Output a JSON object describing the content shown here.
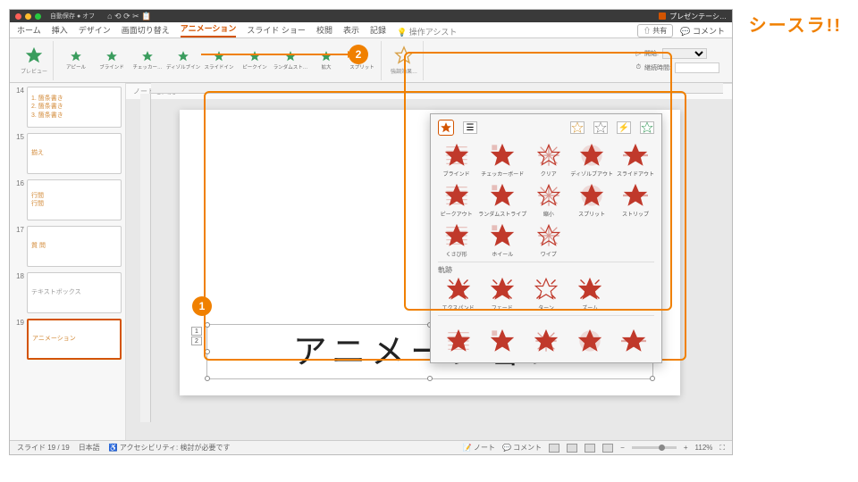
{
  "brand": "シースラ!!",
  "titlebar": {
    "autosave_label": "自動保存",
    "autosave_state": "オフ",
    "filename": "プレゼンテーシ…"
  },
  "tabs": {
    "items": [
      "ホーム",
      "挿入",
      "デザイン",
      "画面切り替え",
      "アニメーション",
      "スライド ショー",
      "校閲",
      "表示",
      "記録"
    ],
    "active_index": 4,
    "tell_me": "操作アシスト",
    "share": "共有",
    "comments": "コメント"
  },
  "ribbon": {
    "preview_label": "プレビュー",
    "entrance_items": [
      "アピール",
      "ブラインド",
      "チェッカー…",
      "ディゾルブイン",
      "スライドイン",
      "ピークイン",
      "ランダムスト…",
      "拡大",
      "スプリット"
    ],
    "emphasize_label": "強調効果…",
    "start_label": "開始:",
    "duration_label": "継続時間:"
  },
  "gallery": {
    "exit_section": "",
    "exit_items": [
      "ブラインド",
      "チェッカーボード",
      "クリア",
      "ディゾルブアウト",
      "スライドアウト",
      "ピークアウト",
      "ランダムストライプ",
      "縮小",
      "スプリット",
      "ストリップ",
      "くさび形",
      "ホイール",
      "ワイプ"
    ],
    "path_section": "軌跡",
    "path_items": [
      "エクスパンド",
      "フェード",
      "ターン",
      "ズーム"
    ],
    "extra_section": ""
  },
  "thumbs": [
    {
      "num": "14",
      "lines": [
        "1. 箇条書き",
        "2. 箇条書き",
        "3. 箇条書き"
      ],
      "color": "orange"
    },
    {
      "num": "15",
      "lines": [
        "揃え"
      ],
      "color": "orange"
    },
    {
      "num": "16",
      "lines": [
        "行間",
        "行間"
      ],
      "color": "orange"
    },
    {
      "num": "17",
      "lines": [
        "質 問"
      ],
      "color": "orange"
    },
    {
      "num": "18",
      "lines": [
        "テキストボックス"
      ],
      "color": "gray"
    },
    {
      "num": "19",
      "lines": [
        "アニメーション"
      ],
      "color": "orange",
      "selected": true
    }
  ],
  "slide": {
    "textbox_text": "アニメーション",
    "anim_tags": [
      "1",
      "2"
    ]
  },
  "notes_placeholder": "ノートを入力",
  "status": {
    "slide": "スライド 19 / 19",
    "lang": "日本語",
    "access": "アクセシビリティ: 検討が必要です",
    "notes_btn": "ノート",
    "comments_btn": "コメント",
    "zoom": "112%"
  },
  "callouts": {
    "one": "1",
    "two": "2"
  }
}
